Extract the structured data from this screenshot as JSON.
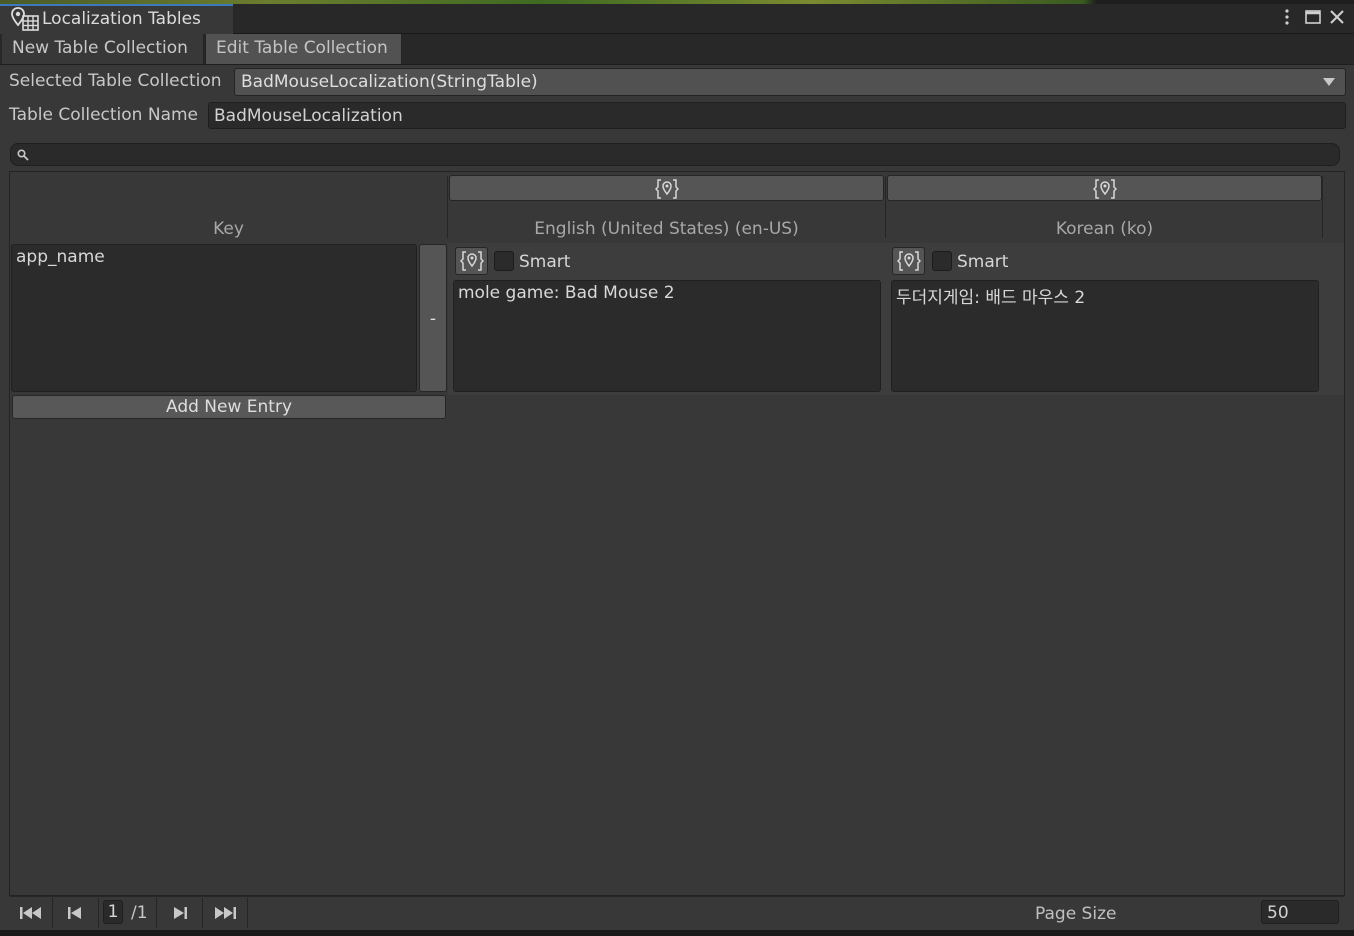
{
  "window": {
    "title": "Localization Tables"
  },
  "tabs": [
    {
      "label": "New Table Collection"
    },
    {
      "label": "Edit Table Collection"
    }
  ],
  "selected_collection": {
    "label": "Selected Table Collection",
    "value": "BadMouseLocalization(StringTable)"
  },
  "collection_name": {
    "label": "Table Collection Name",
    "value": "BadMouseLocalization"
  },
  "search": {
    "placeholder": ""
  },
  "table": {
    "key_header": "Key",
    "columns": [
      {
        "header": "English (United States) (en-US)",
        "smart_label": "Smart",
        "smart_checked": false
      },
      {
        "header": "Korean (ko)",
        "smart_label": "Smart",
        "smart_checked": false
      }
    ],
    "rows": [
      {
        "key": "app_name",
        "remove_label": "-",
        "values": [
          "mole game: Bad Mouse 2",
          "두더지게임: 배드 마우스 2"
        ]
      }
    ],
    "add_entry_label": "Add New Entry"
  },
  "pagination": {
    "current_page": "1",
    "total_pages": "/1",
    "page_size_label": "Page Size",
    "page_size": "50"
  }
}
